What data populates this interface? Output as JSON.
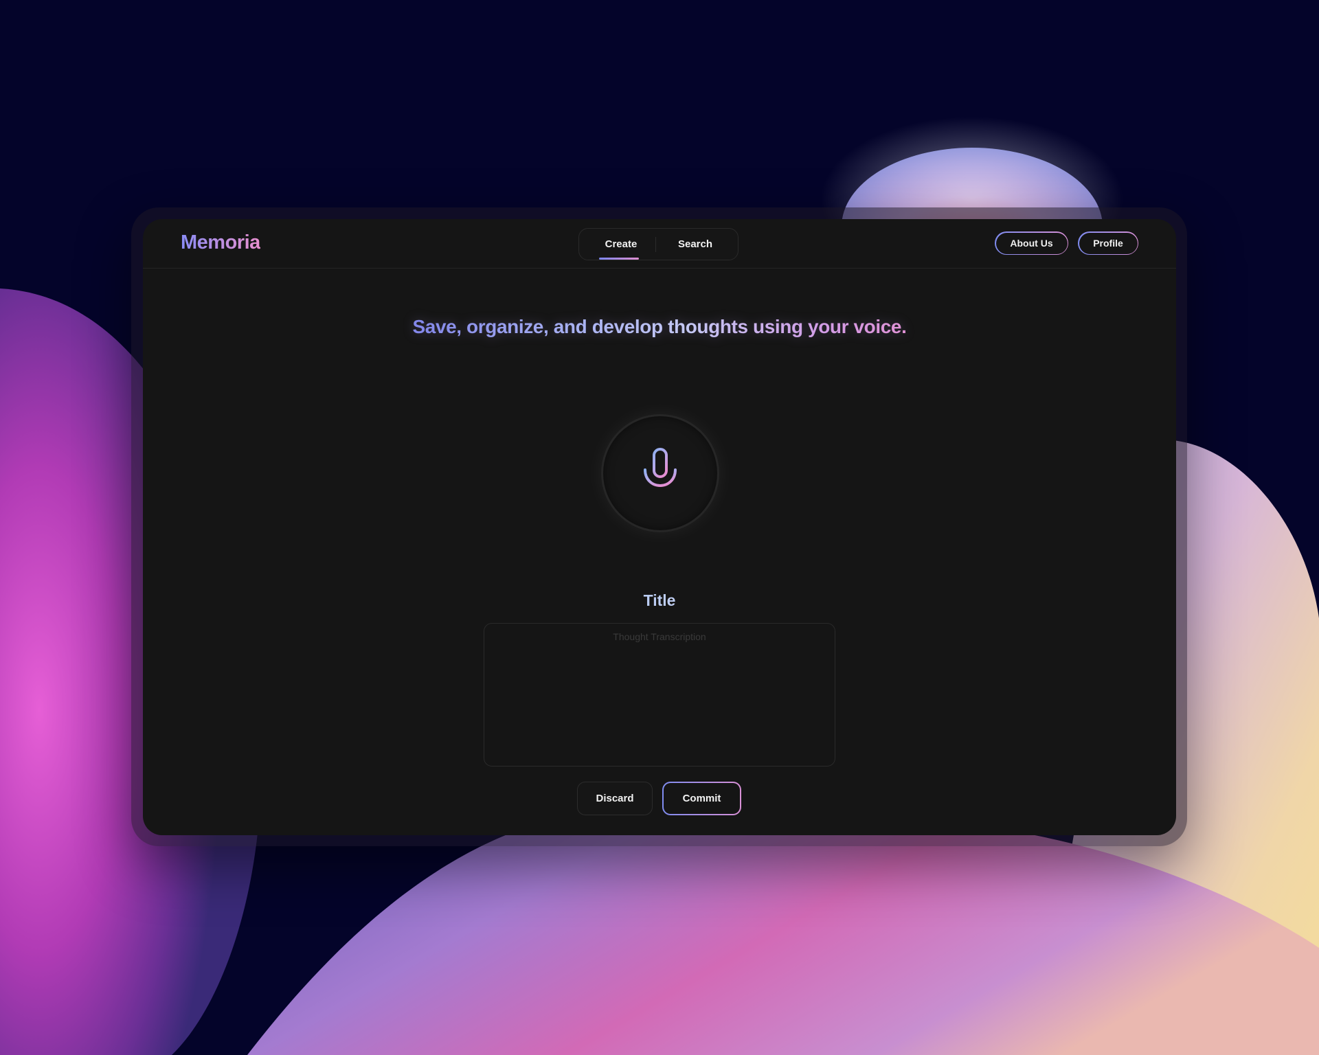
{
  "app": {
    "name": "Memoria"
  },
  "nav": {
    "tabs": [
      {
        "label": "Create",
        "active": true
      },
      {
        "label": "Search",
        "active": false
      }
    ],
    "about_label": "About Us",
    "profile_label": "Profile"
  },
  "hero": {
    "headline": "Save, organize, and develop thoughts using your voice."
  },
  "recorder": {
    "icon": "microphone-icon"
  },
  "form": {
    "title": "Title",
    "transcription": {
      "value": "",
      "placeholder": "Thought Transcription"
    },
    "discard_label": "Discard",
    "commit_label": "Commit"
  },
  "colors": {
    "window_bg": "#151515",
    "accent_blue": "#7f8cf0",
    "accent_pink": "#d890d6",
    "page_bg": "#04042a"
  }
}
